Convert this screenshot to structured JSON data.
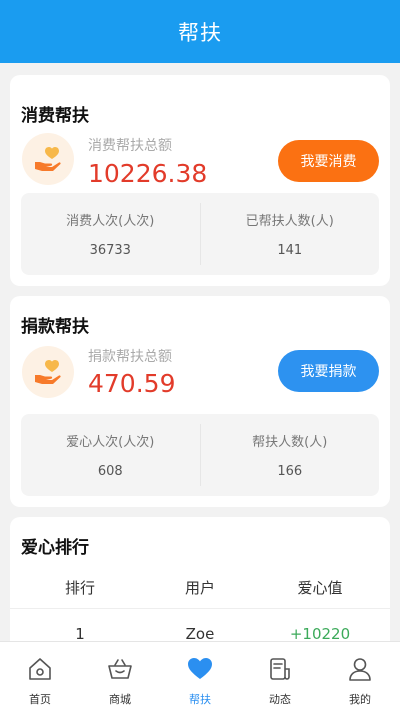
{
  "header": {
    "title": "帮扶"
  },
  "consume": {
    "title": "消费帮扶",
    "amount_label": "消费帮扶总额",
    "amount_value": "10226.38",
    "button_label": "我要消费",
    "icon": "heart-hand-icon",
    "stats": [
      {
        "label": "消费人次(人次)",
        "value": "36733"
      },
      {
        "label": "已帮扶人数(人)",
        "value": "141"
      }
    ]
  },
  "donate": {
    "title": "捐款帮扶",
    "amount_label": "捐款帮扶总额",
    "amount_value": "470.59",
    "button_label": "我要捐款",
    "icon": "heart-hand-icon",
    "stats": [
      {
        "label": "爱心人次(人次)",
        "value": "608"
      },
      {
        "label": "帮扶人数(人)",
        "value": "166"
      }
    ]
  },
  "ranking": {
    "title": "爱心排行",
    "columns": [
      "排行",
      "用户",
      "爱心值"
    ],
    "rows": [
      {
        "rank": "1",
        "user": "Zoe",
        "value": "+10220"
      }
    ]
  },
  "tabbar": {
    "items": [
      {
        "label": "首页",
        "icon": "home-icon"
      },
      {
        "label": "商城",
        "icon": "basket-icon"
      },
      {
        "label": "帮扶",
        "icon": "heart-icon"
      },
      {
        "label": "动态",
        "icon": "document-icon"
      },
      {
        "label": "我的",
        "icon": "user-icon"
      }
    ],
    "active_index": 2
  },
  "colors": {
    "header": "#1a9cf0",
    "accent_orange": "#fb7112",
    "accent_blue": "#2d92f0",
    "amount_red": "#e23b2a",
    "gain_green": "#3caa5a",
    "tab_active": "#2b8ff0"
  }
}
